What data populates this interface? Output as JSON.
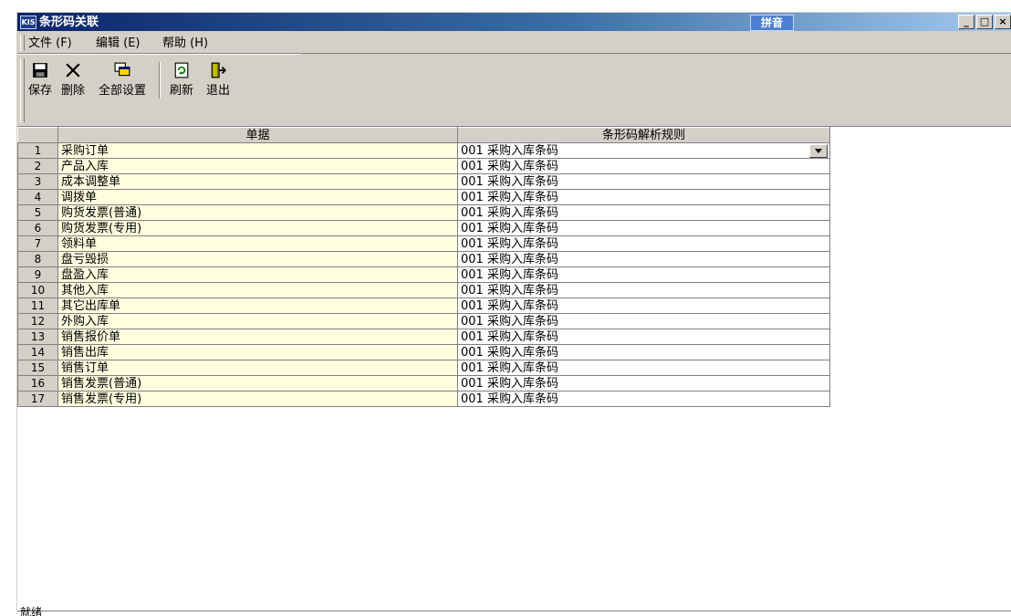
{
  "window": {
    "title": "条形码关联",
    "app_icon_text": "KIS",
    "ime_badge": "拼音",
    "controls": {
      "minimize": "_",
      "maximize": "□",
      "close": "×"
    }
  },
  "menu": [
    {
      "label": "文件 (F)"
    },
    {
      "label": "编辑 (E)"
    },
    {
      "label": "帮助 (H)"
    }
  ],
  "toolbar": [
    {
      "label": "保存",
      "icon": "save-icon"
    },
    {
      "label": "删除",
      "icon": "delete-icon"
    },
    {
      "label": "全部设置",
      "icon": "set-all-icon"
    },
    {
      "label": "刷新",
      "icon": "refresh-icon"
    },
    {
      "label": "退出",
      "icon": "exit-icon"
    }
  ],
  "grid": {
    "columns": [
      "单据",
      "条形码解析规则"
    ],
    "rows": [
      {
        "num": "1",
        "doc": "采购订单",
        "rule": "001 采购入库条码"
      },
      {
        "num": "2",
        "doc": "产品入库",
        "rule": "001 采购入库条码"
      },
      {
        "num": "3",
        "doc": "成本调整单",
        "rule": "001 采购入库条码"
      },
      {
        "num": "4",
        "doc": "调拨单",
        "rule": "001 采购入库条码"
      },
      {
        "num": "5",
        "doc": "购货发票(普通)",
        "rule": "001 采购入库条码"
      },
      {
        "num": "6",
        "doc": "购货发票(专用)",
        "rule": "001 采购入库条码"
      },
      {
        "num": "7",
        "doc": "领料单",
        "rule": "001 采购入库条码"
      },
      {
        "num": "8",
        "doc": "盘亏毁损",
        "rule": "001 采购入库条码"
      },
      {
        "num": "9",
        "doc": "盘盈入库",
        "rule": "001 采购入库条码"
      },
      {
        "num": "10",
        "doc": "其他入库",
        "rule": "001 采购入库条码"
      },
      {
        "num": "11",
        "doc": "其它出库单",
        "rule": "001 采购入库条码"
      },
      {
        "num": "12",
        "doc": "外购入库",
        "rule": "001 采购入库条码"
      },
      {
        "num": "13",
        "doc": "销售报价单",
        "rule": "001 采购入库条码"
      },
      {
        "num": "14",
        "doc": "销售出库",
        "rule": "001 采购入库条码"
      },
      {
        "num": "15",
        "doc": "销售订单",
        "rule": "001 采购入库条码"
      },
      {
        "num": "16",
        "doc": "销售发票(普通)",
        "rule": "001 采购入库条码"
      },
      {
        "num": "17",
        "doc": "销售发票(专用)",
        "rule": "001 采购入库条码"
      }
    ]
  },
  "status": {
    "text": "就绪"
  }
}
